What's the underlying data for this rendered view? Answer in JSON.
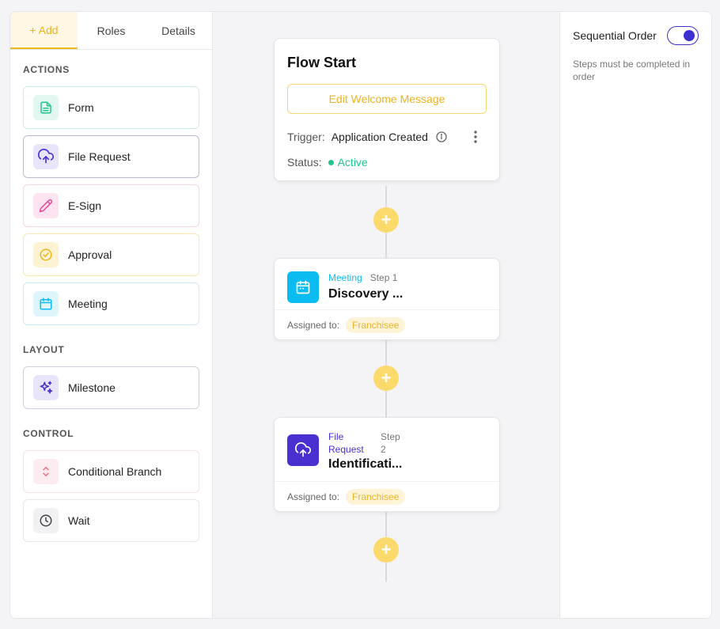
{
  "tabs": [
    {
      "label": "+ Add"
    },
    {
      "label": "Roles"
    },
    {
      "label": "Details"
    }
  ],
  "sections": {
    "actions": "ACTIONS",
    "layout": "LAYOUT",
    "control": "CONTROL"
  },
  "actions": [
    {
      "label": "Form",
      "icon": "form-icon"
    },
    {
      "label": "File Request",
      "icon": "upload-cloud-icon"
    },
    {
      "label": "E-Sign",
      "icon": "pencil-icon"
    },
    {
      "label": "Approval",
      "icon": "check-circle-icon"
    },
    {
      "label": "Meeting",
      "icon": "calendar-icon"
    }
  ],
  "layout_items": [
    {
      "label": "Milestone",
      "icon": "sparkle-icon"
    }
  ],
  "control_items": [
    {
      "label": "Conditional Branch",
      "icon": "branch-arrows-icon"
    },
    {
      "label": "Wait",
      "icon": "clock-icon"
    }
  ],
  "flow_start": {
    "title": "Flow Start",
    "welcome_button": "Edit Welcome Message",
    "trigger_key": "Trigger:",
    "trigger_value": "Application Created",
    "status_key": "Status:",
    "status_value": "Active"
  },
  "steps": [
    {
      "type": "Meeting",
      "step": "Step 1",
      "name": "Discovery ...",
      "assigned_key": "Assigned to:",
      "assignee": "Franchisee",
      "color": "#0bbcf2"
    },
    {
      "type_line1": "File",
      "type_line2": "Request",
      "step_line1": "Step",
      "step_line2": "2",
      "name": "Identificati...",
      "assigned_key": "Assigned to:",
      "assignee": "Franchisee",
      "color": "#4a2fd1"
    }
  ],
  "settings": {
    "sequential_label": "Sequential Order",
    "sequential_on": true,
    "sequential_help": "Steps must be completed in order"
  },
  "colors": {
    "accent_yellow": "#f1b81e",
    "active_green": "#1fc68c",
    "toggle_purple": "#3d2fd0"
  }
}
